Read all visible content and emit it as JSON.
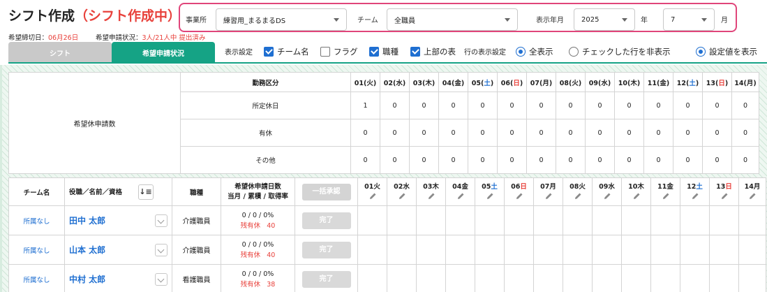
{
  "header": {
    "title": "シフト作成",
    "status": "（シフト作成中）"
  },
  "filters": {
    "office_label": "事業所",
    "office_value": "練習用_まるまるDS",
    "team_label": "チーム",
    "team_value": "全職員",
    "month_label": "表示年月",
    "year_value": "2025",
    "year_unit": "年",
    "month_value": "7",
    "month_unit": "月"
  },
  "info": {
    "deadline_label": "希望締切日：",
    "deadline_value": "06月26日",
    "status_label": "希望申請状況：",
    "status_value": "3人/21人中 提出済み"
  },
  "tabs": [
    {
      "label": "シフト"
    },
    {
      "label": "希望申請状況"
    }
  ],
  "options": {
    "display_settings_label": "表示設定",
    "team_name": "チーム名",
    "flag": "フラグ",
    "job_type": "職種",
    "top_table": "上部の表",
    "row_display_label": "行の表示設定",
    "show_all": "全表示",
    "hide_checked": "チェックした行を非表示",
    "show_settings": "設定値を表示"
  },
  "summary": {
    "group_label": "希望休申請数",
    "category_header": "勤務区分",
    "days": [
      {
        "label": "01",
        "dow": "火",
        "kind": "weekday"
      },
      {
        "label": "02",
        "dow": "水",
        "kind": "weekday"
      },
      {
        "label": "03",
        "dow": "木",
        "kind": "weekday"
      },
      {
        "label": "04",
        "dow": "金",
        "kind": "weekday"
      },
      {
        "label": "05",
        "dow": "土",
        "kind": "sat"
      },
      {
        "label": "06",
        "dow": "日",
        "kind": "sun"
      },
      {
        "label": "07",
        "dow": "月",
        "kind": "weekday"
      },
      {
        "label": "08",
        "dow": "火",
        "kind": "weekday"
      },
      {
        "label": "09",
        "dow": "水",
        "kind": "weekday"
      },
      {
        "label": "10",
        "dow": "木",
        "kind": "weekday"
      },
      {
        "label": "11",
        "dow": "金",
        "kind": "weekday"
      },
      {
        "label": "12",
        "dow": "土",
        "kind": "sat"
      },
      {
        "label": "13",
        "dow": "日",
        "kind": "sun"
      },
      {
        "label": "14",
        "dow": "月",
        "kind": "weekday"
      }
    ],
    "rows": [
      {
        "label": "所定休日",
        "values": [
          "1",
          "0",
          "0",
          "0",
          "0",
          "0",
          "0",
          "0",
          "0",
          "0",
          "0",
          "0",
          "0",
          "0"
        ]
      },
      {
        "label": "有休",
        "values": [
          "0",
          "0",
          "0",
          "0",
          "0",
          "0",
          "0",
          "0",
          "0",
          "0",
          "0",
          "0",
          "0",
          "0"
        ]
      },
      {
        "label": "その他",
        "values": [
          "0",
          "0",
          "0",
          "0",
          "0",
          "0",
          "0",
          "0",
          "0",
          "0",
          "0",
          "0",
          "0",
          "0"
        ]
      }
    ]
  },
  "staff_table": {
    "headers": {
      "team": "チーム名",
      "name": "役職／名前／資格",
      "sort_icon": "↓≡",
      "job": "職種",
      "days_line1": "希望休申請日数",
      "days_line2": "当月 / 累積 / 取得率",
      "bulk_approve": "一括承認"
    },
    "day_headers": [
      {
        "label": "01",
        "dow": "火",
        "kind": "weekday"
      },
      {
        "label": "02",
        "dow": "水",
        "kind": "weekday"
      },
      {
        "label": "03",
        "dow": "木",
        "kind": "weekday"
      },
      {
        "label": "04",
        "dow": "金",
        "kind": "weekday"
      },
      {
        "label": "05",
        "dow": "土",
        "kind": "sat"
      },
      {
        "label": "06",
        "dow": "日",
        "kind": "sun"
      },
      {
        "label": "07",
        "dow": "月",
        "kind": "weekday"
      },
      {
        "label": "08",
        "dow": "火",
        "kind": "weekday"
      },
      {
        "label": "09",
        "dow": "水",
        "kind": "weekday"
      },
      {
        "label": "10",
        "dow": "木",
        "kind": "weekday"
      },
      {
        "label": "11",
        "dow": "金",
        "kind": "weekday"
      },
      {
        "label": "12",
        "dow": "土",
        "kind": "sat"
      },
      {
        "label": "13",
        "dow": "日",
        "kind": "sun"
      },
      {
        "label": "14",
        "dow": "月",
        "kind": "weekday"
      }
    ],
    "rows": [
      {
        "team": "所属なし",
        "name": "田中 太郎",
        "job": "介護職員",
        "ratio": "0 / 0 / 0%",
        "remaining_label": "残有休",
        "remaining_value": "40",
        "status": "完了"
      },
      {
        "team": "所属なし",
        "name": "山本 太郎",
        "job": "介護職員",
        "ratio": "0 / 0 / 0%",
        "remaining_label": "残有休",
        "remaining_value": "40",
        "status": "完了"
      },
      {
        "team": "所属なし",
        "name": "中村 太郎",
        "job": "看護職員",
        "ratio": "0 / 0 / 0%",
        "remaining_label": "残有休",
        "remaining_value": "38",
        "status": "完了"
      }
    ]
  },
  "colors": {
    "accent_green": "#15a385",
    "highlight_pink": "#e0457a",
    "link_blue": "#1f6fd1",
    "alert_red": "#e8413b"
  }
}
